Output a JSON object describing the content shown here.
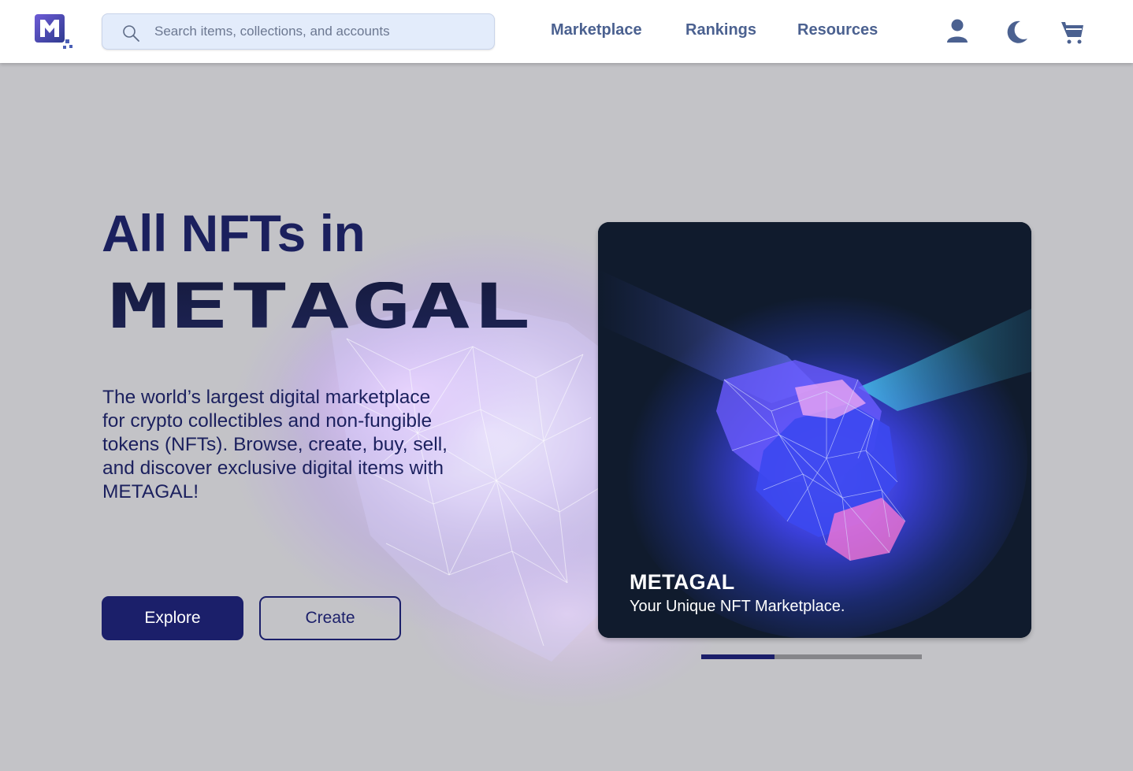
{
  "header": {
    "logo_text": "M",
    "search": {
      "placeholder": "Search items, collections, and accounts",
      "value": ""
    },
    "nav": [
      {
        "label": "Marketplace"
      },
      {
        "label": "Rankings"
      },
      {
        "label": "Resources"
      }
    ],
    "icons": [
      "user-icon",
      "moon-icon",
      "cart-icon"
    ]
  },
  "hero": {
    "title": "All NFTs in",
    "brand_word": "METAGAL",
    "description": "The world’s largest digital marketplace for crypto collectibles and non-fungible tokens (NFTs). Browse, create, buy, sell, and discover exclusive digital items with METAGAL!",
    "buttons": {
      "explore": "Explore",
      "create": "Create"
    }
  },
  "carousel": {
    "slide_title": "METAGAL",
    "slide_subtitle": "Your Unique NFT Marketplace.",
    "progress": 0.333
  },
  "colors": {
    "primary": "#1b1f6a",
    "nav_text": "#4b6190",
    "page_bg": "#c3c3c7",
    "search_bg": "#e3ecfb",
    "card_bg": "#101b2d"
  }
}
